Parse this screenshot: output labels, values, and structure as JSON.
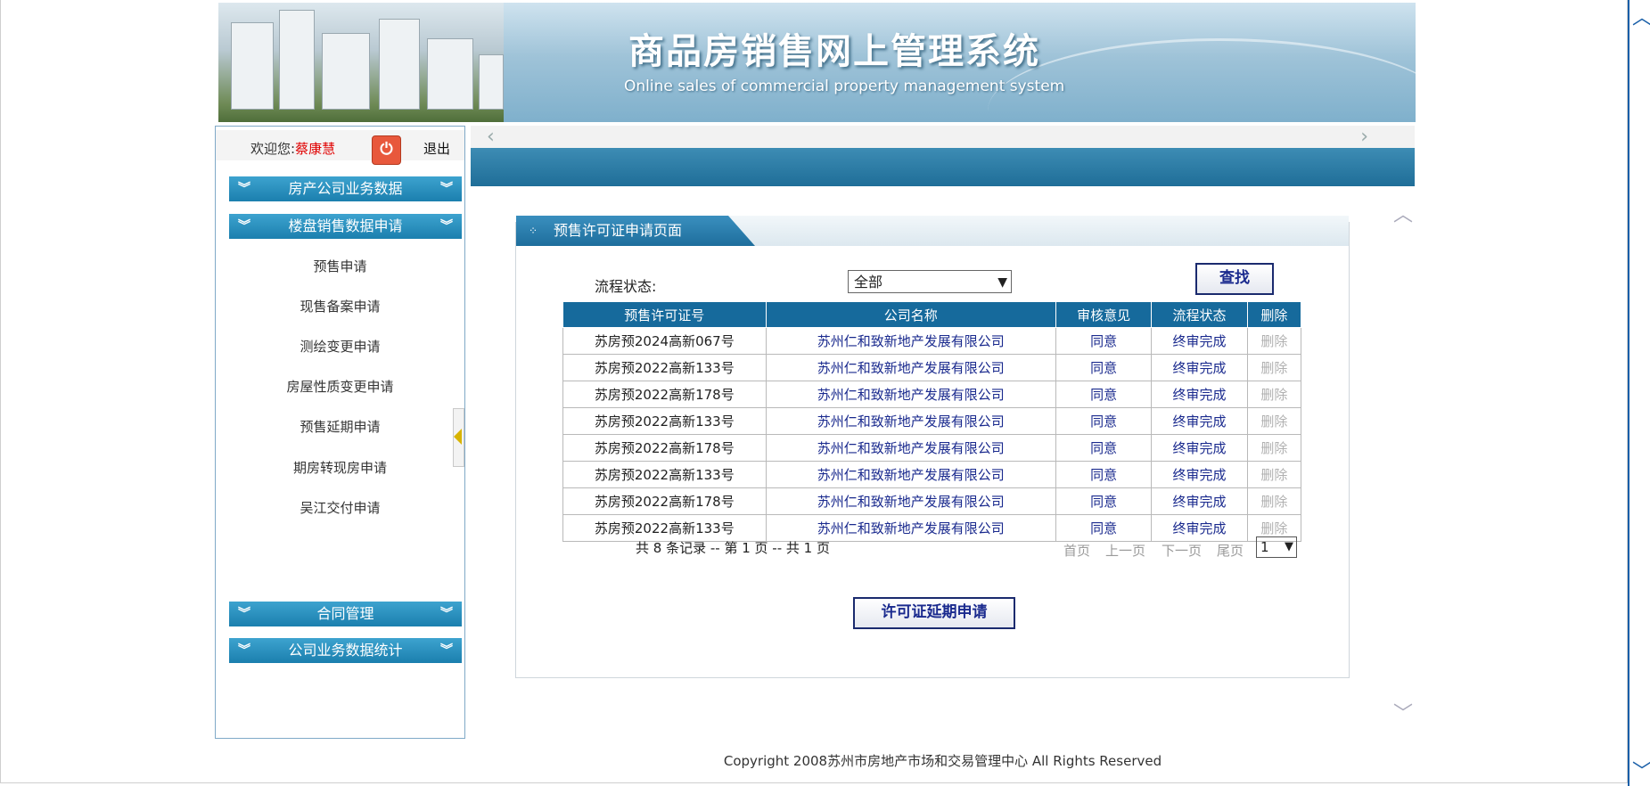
{
  "header": {
    "system_name": "商品房销售网上管理系统",
    "system_name_en": "Online sales of commercial property management system"
  },
  "sidebar": {
    "welcome_label": "欢迎您:",
    "user_name": "蔡康慧",
    "logout_label": "退出",
    "menu_groups": [
      {
        "label": "房产公司业务数据"
      },
      {
        "label": "楼盘销售数据申请"
      },
      {
        "label": "合同管理"
      },
      {
        "label": "公司业务数据统计"
      }
    ],
    "sub_items": [
      {
        "label": "预售申请"
      },
      {
        "label": "现售备案申请"
      },
      {
        "label": "测绘变更申请"
      },
      {
        "label": "房屋性质变更申请"
      },
      {
        "label": "预售延期申请"
      },
      {
        "label": "期房转现房申请"
      },
      {
        "label": "吴江交付申请"
      }
    ]
  },
  "panel": {
    "title": "预售许可证申请页面",
    "filter_label": "流程状态:",
    "filter_value": "全部",
    "search_button": "查找",
    "columns": [
      "预售许可证号",
      "公司名称",
      "审核意见",
      "流程状态",
      "删除"
    ],
    "rows": [
      {
        "cert": "苏房预2024高新067号",
        "company": "苏州仁和致新地产发展有限公司",
        "opinion": "同意",
        "status": "终审完成",
        "delete": "删除"
      },
      {
        "cert": "苏房预2022高新133号",
        "company": "苏州仁和致新地产发展有限公司",
        "opinion": "同意",
        "status": "终审完成",
        "delete": "删除"
      },
      {
        "cert": "苏房预2022高新178号",
        "company": "苏州仁和致新地产发展有限公司",
        "opinion": "同意",
        "status": "终审完成",
        "delete": "删除"
      },
      {
        "cert": "苏房预2022高新133号",
        "company": "苏州仁和致新地产发展有限公司",
        "opinion": "同意",
        "status": "终审完成",
        "delete": "删除"
      },
      {
        "cert": "苏房预2022高新178号",
        "company": "苏州仁和致新地产发展有限公司",
        "opinion": "同意",
        "status": "终审完成",
        "delete": "删除"
      },
      {
        "cert": "苏房预2022高新133号",
        "company": "苏州仁和致新地产发展有限公司",
        "opinion": "同意",
        "status": "终审完成",
        "delete": "删除"
      },
      {
        "cert": "苏房预2022高新178号",
        "company": "苏州仁和致新地产发展有限公司",
        "opinion": "同意",
        "status": "终审完成",
        "delete": "删除"
      },
      {
        "cert": "苏房预2022高新133号",
        "company": "苏州仁和致新地产发展有限公司",
        "opinion": "同意",
        "status": "终审完成",
        "delete": "删除"
      }
    ],
    "record_info": "共 8 条记录 -- 第 1 页 -- 共 1 页",
    "pager": {
      "first": "首页",
      "prev": "上一页",
      "next": "下一页",
      "last": "尾页",
      "page": "1"
    },
    "extend_button": "许可证延期申请"
  },
  "footer": {
    "copyright": "Copyright 2008苏州市房地产市场和交易管理中心  All Rights Reserved"
  },
  "colors": {
    "menu_blue": "#1b7fae",
    "header_blue": "#166a9c",
    "link_navy": "#1a2a8e",
    "user_red": "#e00000"
  }
}
